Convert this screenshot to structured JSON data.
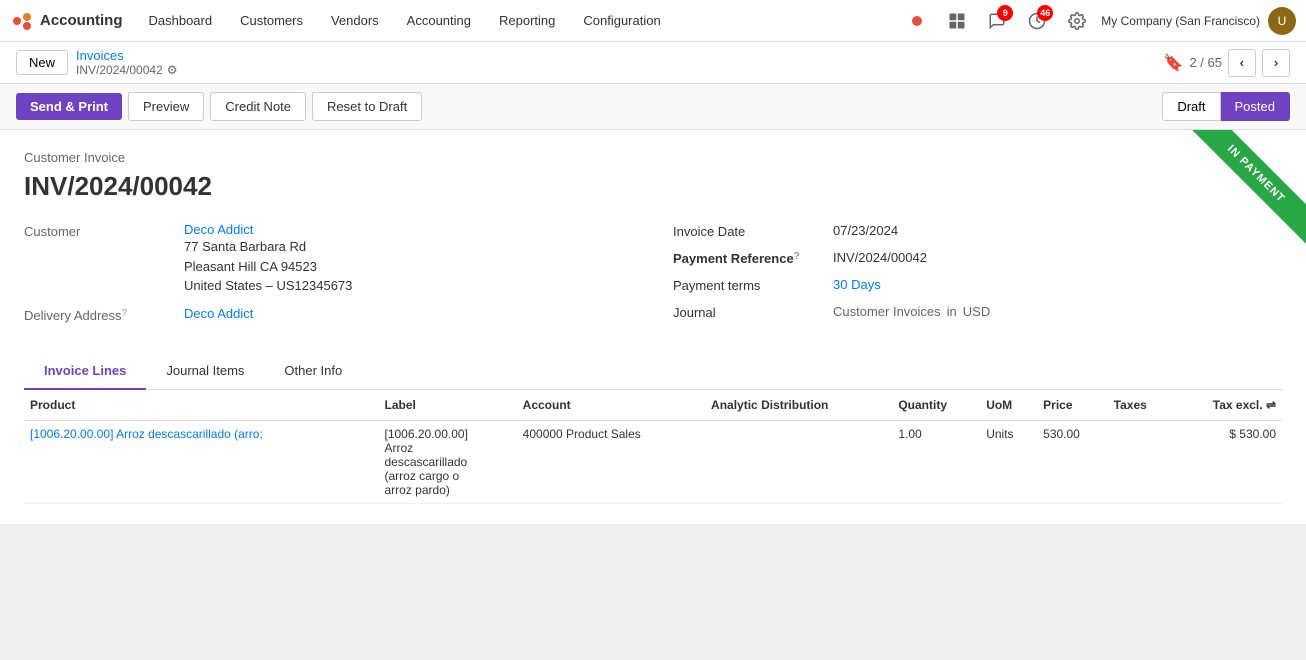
{
  "nav": {
    "app_name": "Accounting",
    "items": [
      "Dashboard",
      "Customers",
      "Vendors",
      "Accounting",
      "Reporting",
      "Configuration"
    ],
    "company": "My Company (San Francisco)",
    "badge_messages": "9",
    "badge_activities": "46"
  },
  "breadcrumb": {
    "new_label": "New",
    "parent": "Invoices",
    "current": "INV/2024/00042",
    "page_current": "2",
    "page_total": "65"
  },
  "actions": {
    "send_print": "Send & Print",
    "preview": "Preview",
    "credit_note": "Credit Note",
    "reset_draft": "Reset to Draft",
    "status_draft": "Draft",
    "status_posted": "Posted"
  },
  "invoice": {
    "type": "Customer Invoice",
    "number": "INV/2024/00042",
    "customer_label": "Customer",
    "customer_name": "Deco Addict",
    "address_line1": "77 Santa Barbara Rd",
    "address_line2": "Pleasant Hill CA 94523",
    "address_line3": "United States – US12345673",
    "delivery_address_label": "Delivery Address",
    "delivery_address_name": "Deco Addict",
    "invoice_date_label": "Invoice Date",
    "invoice_date": "07/23/2024",
    "payment_ref_label": "Payment Reference",
    "payment_ref": "INV/2024/00042",
    "payment_terms_label": "Payment terms",
    "payment_terms": "30 Days",
    "journal_label": "Journal",
    "journal_value": "Customer Invoices",
    "journal_in": "in",
    "journal_currency": "USD",
    "banner_text": "IN PAYMENT"
  },
  "tabs": [
    {
      "label": "Invoice Lines",
      "active": true
    },
    {
      "label": "Journal Items",
      "active": false
    },
    {
      "label": "Other Info",
      "active": false
    }
  ],
  "table": {
    "columns": [
      "Product",
      "Label",
      "Account",
      "Analytic Distribution",
      "Quantity",
      "UoM",
      "Price",
      "Taxes",
      "Tax excl."
    ],
    "rows": [
      {
        "product": "[1006.20.00.00] Arroz descascarillado (arro;",
        "label": "[1006.20.00.00]\nArroz\ndescascarillado\n(arroz cargo o\narroz pardo)",
        "account": "400000 Product Sales",
        "analytic": "",
        "quantity": "1.00",
        "uom": "Units",
        "price": "530.00",
        "taxes": "",
        "tax_excl": "$ 530.00"
      }
    ]
  }
}
